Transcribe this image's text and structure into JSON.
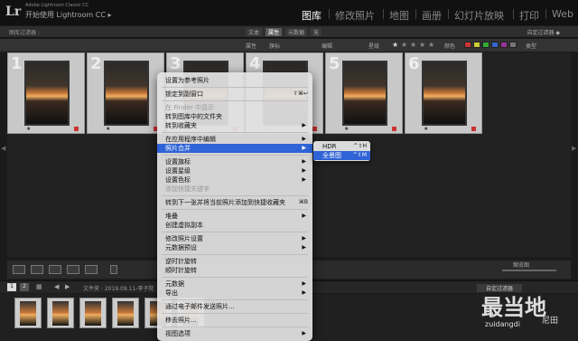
{
  "app": {
    "logo": "Lr",
    "subtitle": "Adobe Lightroom Classic CC",
    "title": "开始使用 Lightroom CC ▸"
  },
  "modules": [
    "图库",
    "修改照片",
    "地图",
    "画册",
    "幻灯片放映",
    "打印",
    "Web"
  ],
  "active_module": "图库",
  "filter_bar": {
    "title": "图库过滤器 :",
    "tabs": [
      "文本",
      "属性",
      "元数据",
      "无"
    ],
    "selected_tab": "属性",
    "custom_filter": "自定过滤器 ◆"
  },
  "attribute_bar": {
    "attr_label": "属性",
    "flag_label": "旗标",
    "edit_label": "编辑",
    "rating_label": "星级",
    "color_label": "颜色",
    "type_label": "类型"
  },
  "grid_numbers": [
    "1",
    "2",
    "3",
    "4",
    "5",
    "6"
  ],
  "toolbar": {
    "thumb_label": "缩览图"
  },
  "filmstrip_bar": {
    "pages": [
      "1",
      "2"
    ],
    "path": "文件夹 : 2019.09.11-李子院",
    "filter": "自定过滤器"
  },
  "context_menu": [
    {
      "label": "设置为参考照片",
      "state": "normal"
    },
    {
      "sep": true
    },
    {
      "label": "锁定到副窗口",
      "state": "normal",
      "shortcut": "⇧⌘↩"
    },
    {
      "sep": true
    },
    {
      "label": "在 Finder 中显示",
      "state": "disabled"
    },
    {
      "label": "转到图库中的文件夹",
      "state": "normal"
    },
    {
      "label": "转到收藏夹",
      "state": "normal",
      "arrow": "▶"
    },
    {
      "sep": true
    },
    {
      "label": "在应用程序中编辑",
      "state": "normal",
      "arrow": "▶"
    },
    {
      "label": "照片合并",
      "state": "highlight",
      "arrow": "▶"
    },
    {
      "sep": true
    },
    {
      "label": "设置旗标",
      "state": "normal",
      "arrow": "▶"
    },
    {
      "label": "设置星级",
      "state": "normal",
      "arrow": "▶"
    },
    {
      "label": "设置色标",
      "state": "normal",
      "arrow": "▶"
    },
    {
      "label": "添加快捷关键字",
      "state": "disabled"
    },
    {
      "sep": true
    },
    {
      "label": "转到下一张并将当前照片添加到快捷收藏夹",
      "state": "normal",
      "shortcut": "⌘B"
    },
    {
      "sep": true
    },
    {
      "label": "堆叠",
      "state": "normal",
      "arrow": "▶"
    },
    {
      "label": "创建虚拟副本",
      "state": "normal"
    },
    {
      "sep": true
    },
    {
      "label": "修改照片设置",
      "state": "normal",
      "arrow": "▶"
    },
    {
      "label": "元数据预设",
      "state": "normal",
      "arrow": "▶"
    },
    {
      "sep": true
    },
    {
      "label": "逆时针旋转",
      "state": "normal"
    },
    {
      "label": "顺时针旋转",
      "state": "normal"
    },
    {
      "sep": true
    },
    {
      "label": "元数据",
      "state": "normal",
      "arrow": "▶"
    },
    {
      "label": "导出",
      "state": "normal",
      "arrow": "▶"
    },
    {
      "sep": true
    },
    {
      "label": "通过电子邮件发送照片...",
      "state": "normal"
    },
    {
      "sep": true
    },
    {
      "label": "移去照片...",
      "state": "normal"
    },
    {
      "sep": true
    },
    {
      "label": "视图选项",
      "state": "normal",
      "arrow": "▶"
    }
  ],
  "submenu": [
    {
      "label": "HDR",
      "shortcut": "^⇧H",
      "state": "normal"
    },
    {
      "label": "全景图",
      "shortcut": "^⇧M",
      "state": "highlight"
    }
  ],
  "watermark": {
    "big": "最当地",
    "small": "zuidangdi",
    "credit": "尼田"
  },
  "colors": {
    "highlight": "#2f63d6",
    "active_module": "#ffffff",
    "menu_bg": "#e2e2e2"
  }
}
